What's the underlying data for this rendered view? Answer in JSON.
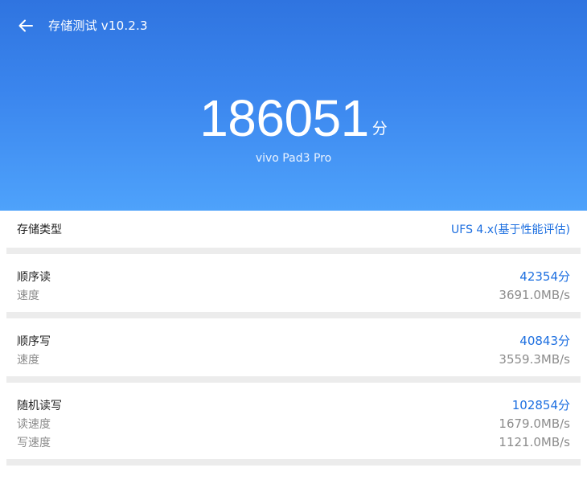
{
  "header": {
    "title": "存储测试 v10.2.3",
    "back_icon": "arrow-left-icon"
  },
  "score": {
    "value": "186051",
    "unit": "分",
    "device": "vivo Pad3 Pro"
  },
  "storage_type": {
    "label": "存储类型",
    "value": "UFS 4.x(基于性能评估)"
  },
  "sequential_read": {
    "label": "顺序读",
    "score": "42354分",
    "speed_label": "速度",
    "speed": "3691.0MB/s"
  },
  "sequential_write": {
    "label": "顺序写",
    "score": "40843分",
    "speed_label": "速度",
    "speed": "3559.3MB/s"
  },
  "random_rw": {
    "label": "随机读写",
    "score": "102854分",
    "read_label": "读速度",
    "read_speed": "1679.0MB/s",
    "write_label": "写速度",
    "write_speed": "1121.0MB/s"
  },
  "colors": {
    "header_top": "#2f74e0",
    "header_bottom": "#4ea2fb",
    "accent": "#1d6fe0",
    "separator": "#ececec"
  }
}
